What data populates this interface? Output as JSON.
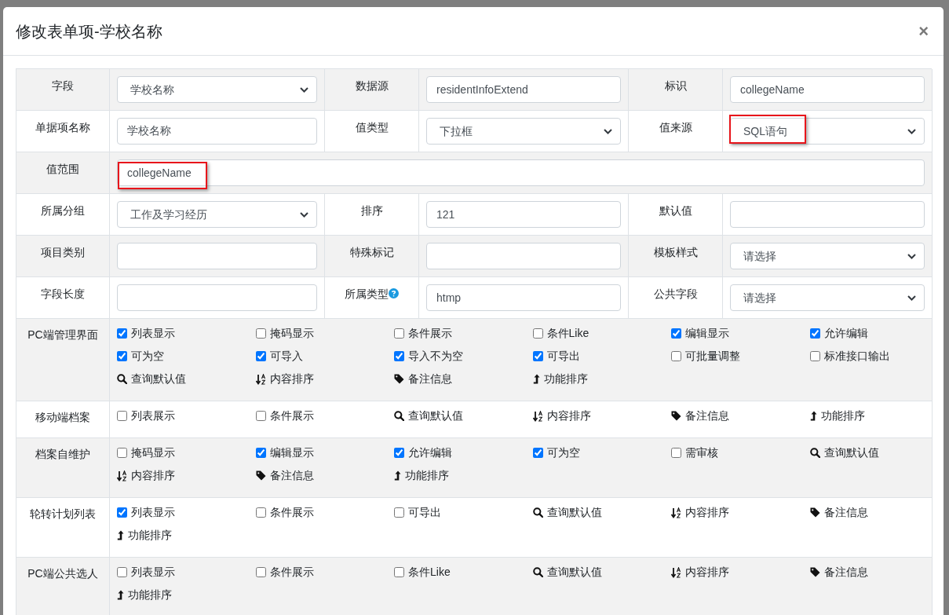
{
  "dialog": {
    "title": "修改表单项-学校名称",
    "close": "×"
  },
  "form_rows": [
    {
      "cells": [
        {
          "label": "字段",
          "help": false,
          "field": {
            "kind": "select",
            "value": "学校名称",
            "highlighted": false
          }
        },
        {
          "label": "数据源",
          "help": false,
          "field": {
            "kind": "text",
            "value": "residentInfoExtend",
            "highlighted": false
          }
        },
        {
          "label": "标识",
          "help": false,
          "field": {
            "kind": "text",
            "value": "collegeName",
            "highlighted": false
          }
        }
      ]
    },
    {
      "cells": [
        {
          "label": "单据项名称",
          "help": false,
          "field": {
            "kind": "text",
            "value": "学校名称",
            "highlighted": false
          }
        },
        {
          "label": "值类型",
          "help": false,
          "field": {
            "kind": "select",
            "value": "下拉框",
            "highlighted": false
          }
        },
        {
          "label": "值来源",
          "help": false,
          "field": {
            "kind": "select",
            "value": "SQL语句",
            "highlighted": true
          }
        }
      ]
    },
    {
      "cells": [
        {
          "label": "值范围",
          "help": false,
          "field": {
            "kind": "text",
            "value": "collegeName",
            "highlighted": true
          }
        }
      ]
    },
    {
      "cells": [
        {
          "label": "所属分组",
          "help": false,
          "field": {
            "kind": "select",
            "value": "工作及学习经历",
            "highlighted": false
          }
        },
        {
          "label": "排序",
          "help": false,
          "field": {
            "kind": "text",
            "value": "121",
            "highlighted": false
          }
        },
        {
          "label": "默认值",
          "help": false,
          "field": {
            "kind": "text",
            "highlighted": false
          }
        }
      ]
    },
    {
      "cells": [
        {
          "label": "项目类别",
          "help": false,
          "field": {
            "kind": "text",
            "highlighted": false
          }
        },
        {
          "label": "特殊标记",
          "help": false,
          "field": {
            "kind": "text",
            "highlighted": false
          }
        },
        {
          "label": "模板样式",
          "help": false,
          "field": {
            "kind": "select",
            "value": "请选择",
            "highlighted": false
          }
        }
      ]
    },
    {
      "cells": [
        {
          "label": "字段长度",
          "help": false,
          "field": {
            "kind": "text",
            "highlighted": false
          }
        },
        {
          "label": "所属类型",
          "help": true,
          "field": {
            "kind": "text",
            "value": "htmp",
            "highlighted": false
          }
        },
        {
          "label": "公共字段",
          "help": false,
          "field": {
            "kind": "select",
            "value": "请选择",
            "highlighted": false
          }
        }
      ]
    }
  ],
  "permission_groups": [
    {
      "label": "PC端管理界面",
      "items": [
        {
          "kind": "checkbox",
          "label": "列表显示",
          "checked": true
        },
        {
          "kind": "checkbox",
          "label": "掩码显示",
          "checked": false
        },
        {
          "kind": "checkbox",
          "label": "条件展示",
          "checked": false
        },
        {
          "kind": "checkbox",
          "label": "条件Like",
          "checked": false
        },
        {
          "kind": "checkbox",
          "label": "编辑显示",
          "checked": true
        },
        {
          "kind": "checkbox",
          "label": "允许编辑",
          "checked": true
        },
        {
          "kind": "checkbox",
          "label": "可为空",
          "checked": true
        },
        {
          "kind": "checkbox",
          "label": "可导入",
          "checked": true
        },
        {
          "kind": "checkbox",
          "label": "导入不为空",
          "checked": true
        },
        {
          "kind": "checkbox",
          "label": "可导出",
          "checked": true
        },
        {
          "kind": "checkbox",
          "label": "可批量调整",
          "checked": false
        },
        {
          "kind": "checkbox",
          "label": "标准接口输出",
          "checked": false
        },
        {
          "kind": "query",
          "label": "查询默认值"
        },
        {
          "kind": "sort",
          "label": "内容排序"
        },
        {
          "kind": "remark",
          "label": "备注信息"
        },
        {
          "kind": "reorder",
          "label": "功能排序"
        }
      ]
    },
    {
      "label": "移动端档案",
      "items": [
        {
          "kind": "checkbox",
          "label": "列表展示",
          "checked": false
        },
        {
          "kind": "checkbox",
          "label": "条件展示",
          "checked": false
        },
        {
          "kind": "query",
          "label": "查询默认值"
        },
        {
          "kind": "sort",
          "label": "内容排序"
        },
        {
          "kind": "remark",
          "label": "备注信息"
        },
        {
          "kind": "reorder",
          "label": "功能排序"
        }
      ]
    },
    {
      "label": "档案自维护",
      "items": [
        {
          "kind": "checkbox",
          "label": "掩码显示",
          "checked": false
        },
        {
          "kind": "checkbox",
          "label": "编辑显示",
          "checked": true
        },
        {
          "kind": "checkbox",
          "label": "允许编辑",
          "checked": true
        },
        {
          "kind": "checkbox",
          "label": "可为空",
          "checked": true
        },
        {
          "kind": "checkbox",
          "label": "需审核",
          "checked": false
        },
        {
          "kind": "query",
          "label": "查询默认值"
        },
        {
          "kind": "sort",
          "label": "内容排序"
        },
        {
          "kind": "remark",
          "label": "备注信息"
        },
        {
          "kind": "reorder",
          "label": "功能排序"
        }
      ]
    },
    {
      "label": "轮转计划列表",
      "items": [
        {
          "kind": "checkbox",
          "label": "列表显示",
          "checked": true
        },
        {
          "kind": "checkbox",
          "label": "条件展示",
          "checked": false
        },
        {
          "kind": "checkbox",
          "label": "可导出",
          "checked": false
        },
        {
          "kind": "query",
          "label": "查询默认值"
        },
        {
          "kind": "sort",
          "label": "内容排序"
        },
        {
          "kind": "remark",
          "label": "备注信息"
        },
        {
          "kind": "reorder",
          "label": "功能排序"
        }
      ]
    },
    {
      "label": "PC端公共选人",
      "items": [
        {
          "kind": "checkbox",
          "label": "列表显示",
          "checked": false
        },
        {
          "kind": "checkbox",
          "label": "条件展示",
          "checked": false
        },
        {
          "kind": "checkbox",
          "label": "条件Like",
          "checked": false
        },
        {
          "kind": "query",
          "label": "查询默认值"
        },
        {
          "kind": "sort",
          "label": "内容排序"
        },
        {
          "kind": "remark",
          "label": "备注信息"
        },
        {
          "kind": "reorder",
          "label": "功能排序"
        }
      ]
    }
  ]
}
